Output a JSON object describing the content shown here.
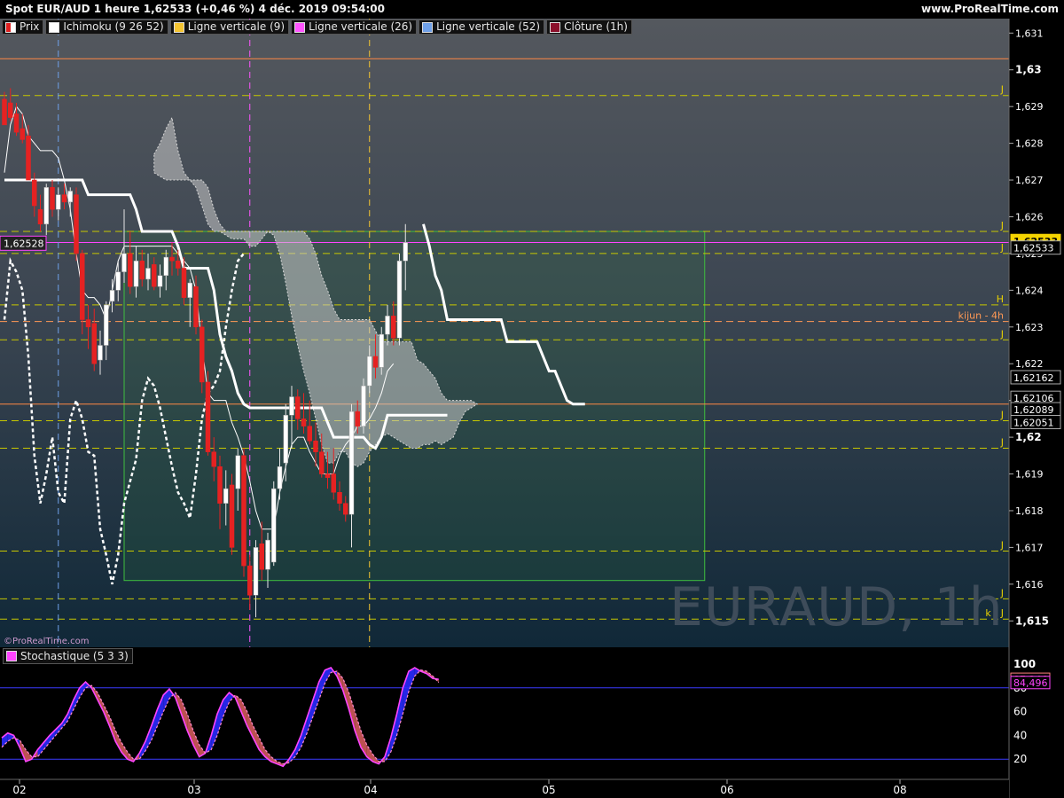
{
  "header": {
    "title": "Spot EUR/AUD 1 heure 1,62533 (+0,46 %) 4 déc. 2019 09:54:00",
    "site": "www.ProRealTime.com",
    "copyright": "©ProRealTime.com",
    "watermark": "EURAUD, 1h"
  },
  "legend": [
    {
      "label": "Prix",
      "color": "#ffffff",
      "accent": "#e02020"
    },
    {
      "label": "Ichimoku (9 26 52)",
      "color": "#ffffff"
    },
    {
      "label": "Ligne verticale (9)",
      "color": "#f5c531"
    },
    {
      "label": "Ligne verticale (26)",
      "color": "#ff55ff"
    },
    {
      "label": "Ligne verticale (52)",
      "color": "#6fa0e8"
    },
    {
      "label": "Clôture (1h)",
      "color": "#8b0f2a"
    }
  ],
  "stoch_legend": {
    "label": "Stochastique (5 3 3)",
    "color": "#ff44ff"
  },
  "chart_data": [
    {
      "type": "candlestick",
      "title": "Spot EUR/AUD 1 heure",
      "x_ticks": [
        "02",
        "03",
        "04",
        "05",
        "06",
        "08"
      ],
      "ylim": [
        1.6145,
        1.6312
      ],
      "y_ticks": [
        "1,631",
        "1,63",
        "1,629",
        "1,628",
        "1,627",
        "1,626",
        "1,625",
        "1,624",
        "1,623",
        "1,622",
        "1,621",
        "1,62",
        "1,619",
        "1,618",
        "1,617",
        "1,616",
        "1,615"
      ],
      "y_tick_values": [
        1.631,
        1.63,
        1.629,
        1.628,
        1.627,
        1.626,
        1.625,
        1.624,
        1.623,
        1.622,
        1.621,
        1.62,
        1.619,
        1.618,
        1.617,
        1.616,
        1.615
      ],
      "bold_ticks": [
        "1,63",
        "1,62",
        "1,615"
      ],
      "price_tags": [
        {
          "label": "1,62533",
          "value": 1.62533,
          "style": "last",
          "bg": "#f5d400",
          "fg": "#000000"
        },
        {
          "label": "1,62533",
          "value": 1.62515,
          "style": "plain"
        },
        {
          "label": "1,62162",
          "value": 1.62162,
          "style": "plain"
        },
        {
          "label": "1,62106",
          "value": 1.62106,
          "style": "plain"
        },
        {
          "label": "1,62089",
          "value": 1.62075,
          "style": "plain"
        },
        {
          "label": "1,62051",
          "value": 1.6204,
          "style": "plain"
        }
      ],
      "left_tag": {
        "label": "1,62528",
        "value": 1.62528
      },
      "level_lines": [
        {
          "value": 1.6303,
          "color": "#ff8844",
          "style": "solid",
          "label": ""
        },
        {
          "value": 1.6293,
          "color": "#c8c800",
          "style": "dash",
          "label": "J"
        },
        {
          "value": 1.6256,
          "color": "#c8c800",
          "style": "dash",
          "label": "J"
        },
        {
          "value": 1.6253,
          "color": "#ff44ff",
          "style": "solid",
          "label": ""
        },
        {
          "value": 1.625,
          "color": "#c8c800",
          "style": "dash",
          "label": "J"
        },
        {
          "value": 1.6236,
          "color": "#c8c800",
          "style": "dash",
          "label": "H"
        },
        {
          "value": 1.62315,
          "color": "#ff9955",
          "style": "dash",
          "label": "kijun - 4h"
        },
        {
          "value": 1.62265,
          "color": "#c8c800",
          "style": "dash",
          "label": "J"
        },
        {
          "value": 1.6209,
          "color": "#ff8844",
          "style": "solid",
          "label": ""
        },
        {
          "value": 1.62045,
          "color": "#c8c800",
          "style": "dash",
          "label": "J"
        },
        {
          "value": 1.6197,
          "color": "#c8c800",
          "style": "dash",
          "label": "J"
        },
        {
          "value": 1.6169,
          "color": "#c8c800",
          "style": "dash",
          "label": "J"
        },
        {
          "value": 1.6156,
          "color": "#c8c800",
          "style": "dash",
          "label": "J"
        },
        {
          "value": 1.61505,
          "color": "#c8c800",
          "style": "dash",
          "label": "k - J"
        }
      ],
      "candles": [
        {
          "o": 1.6292,
          "h": 1.6294,
          "l": 1.6286,
          "c": 1.6285
        },
        {
          "o": 1.6291,
          "h": 1.6295,
          "l": 1.6286,
          "c": 1.6287
        },
        {
          "o": 1.6288,
          "h": 1.6291,
          "l": 1.6282,
          "c": 1.6283
        },
        {
          "o": 1.6284,
          "h": 1.6288,
          "l": 1.628,
          "c": 1.6281
        },
        {
          "o": 1.6282,
          "h": 1.6285,
          "l": 1.6275,
          "c": 1.627
        },
        {
          "o": 1.627,
          "h": 1.6272,
          "l": 1.626,
          "c": 1.6263
        },
        {
          "o": 1.6262,
          "h": 1.6266,
          "l": 1.6256,
          "c": 1.6258
        },
        {
          "o": 1.6258,
          "h": 1.6269,
          "l": 1.6255,
          "c": 1.6268
        },
        {
          "o": 1.6268,
          "h": 1.627,
          "l": 1.626,
          "c": 1.6262
        },
        {
          "o": 1.6262,
          "h": 1.6268,
          "l": 1.6259,
          "c": 1.6266
        },
        {
          "o": 1.6266,
          "h": 1.6269,
          "l": 1.6262,
          "c": 1.6264
        },
        {
          "o": 1.6264,
          "h": 1.6268,
          "l": 1.626,
          "c": 1.6267
        },
        {
          "o": 1.6266,
          "h": 1.6268,
          "l": 1.6248,
          "c": 1.625
        },
        {
          "o": 1.625,
          "h": 1.6251,
          "l": 1.6228,
          "c": 1.6232
        },
        {
          "o": 1.6232,
          "h": 1.6236,
          "l": 1.6224,
          "c": 1.623
        },
        {
          "o": 1.6231,
          "h": 1.6235,
          "l": 1.6218,
          "c": 1.622
        },
        {
          "o": 1.6221,
          "h": 1.6229,
          "l": 1.6217,
          "c": 1.6225
        },
        {
          "o": 1.6225,
          "h": 1.6237,
          "l": 1.6221,
          "c": 1.6236
        },
        {
          "o": 1.6237,
          "h": 1.6243,
          "l": 1.6234,
          "c": 1.624
        },
        {
          "o": 1.624,
          "h": 1.6248,
          "l": 1.6237,
          "c": 1.6245
        },
        {
          "o": 1.6245,
          "h": 1.6262,
          "l": 1.6242,
          "c": 1.625
        },
        {
          "o": 1.625,
          "h": 1.6256,
          "l": 1.6239,
          "c": 1.6241
        },
        {
          "o": 1.6241,
          "h": 1.6252,
          "l": 1.6238,
          "c": 1.6248
        },
        {
          "o": 1.6248,
          "h": 1.6251,
          "l": 1.6241,
          "c": 1.6243
        },
        {
          "o": 1.6243,
          "h": 1.625,
          "l": 1.624,
          "c": 1.6246
        },
        {
          "o": 1.6247,
          "h": 1.6249,
          "l": 1.624,
          "c": 1.6241
        },
        {
          "o": 1.6241,
          "h": 1.6247,
          "l": 1.6238,
          "c": 1.6244
        },
        {
          "o": 1.6244,
          "h": 1.6251,
          "l": 1.624,
          "c": 1.6249
        },
        {
          "o": 1.6249,
          "h": 1.6253,
          "l": 1.6244,
          "c": 1.6248
        },
        {
          "o": 1.6248,
          "h": 1.6251,
          "l": 1.6244,
          "c": 1.6246
        },
        {
          "o": 1.6246,
          "h": 1.6249,
          "l": 1.6236,
          "c": 1.6238
        },
        {
          "o": 1.6238,
          "h": 1.6243,
          "l": 1.623,
          "c": 1.6242
        },
        {
          "o": 1.6241,
          "h": 1.6244,
          "l": 1.6228,
          "c": 1.623
        },
        {
          "o": 1.623,
          "h": 1.6232,
          "l": 1.6212,
          "c": 1.6215
        },
        {
          "o": 1.6215,
          "h": 1.6218,
          "l": 1.6195,
          "c": 1.6196
        },
        {
          "o": 1.6196,
          "h": 1.62,
          "l": 1.6188,
          "c": 1.6192
        },
        {
          "o": 1.6192,
          "h": 1.6195,
          "l": 1.6175,
          "c": 1.6182
        },
        {
          "o": 1.6182,
          "h": 1.6191,
          "l": 1.6176,
          "c": 1.6186
        },
        {
          "o": 1.6187,
          "h": 1.619,
          "l": 1.6168,
          "c": 1.617
        },
        {
          "o": 1.6186,
          "h": 1.6197,
          "l": 1.618,
          "c": 1.6195
        },
        {
          "o": 1.6195,
          "h": 1.6197,
          "l": 1.6162,
          "c": 1.6165
        },
        {
          "o": 1.6165,
          "h": 1.6168,
          "l": 1.6153,
          "c": 1.6157
        },
        {
          "o": 1.6157,
          "h": 1.6172,
          "l": 1.6151,
          "c": 1.617
        },
        {
          "o": 1.6171,
          "h": 1.6177,
          "l": 1.6161,
          "c": 1.6164
        },
        {
          "o": 1.6164,
          "h": 1.6174,
          "l": 1.6159,
          "c": 1.6172
        },
        {
          "o": 1.6166,
          "h": 1.6188,
          "l": 1.6165,
          "c": 1.6186
        },
        {
          "o": 1.6186,
          "h": 1.6197,
          "l": 1.6183,
          "c": 1.6192
        },
        {
          "o": 1.6193,
          "h": 1.6209,
          "l": 1.6188,
          "c": 1.6206
        },
        {
          "o": 1.6206,
          "h": 1.6214,
          "l": 1.6197,
          "c": 1.6211
        },
        {
          "o": 1.6211,
          "h": 1.6213,
          "l": 1.6202,
          "c": 1.6205
        },
        {
          "o": 1.6205,
          "h": 1.6212,
          "l": 1.6201,
          "c": 1.6203
        },
        {
          "o": 1.6203,
          "h": 1.621,
          "l": 1.6198,
          "c": 1.6199
        },
        {
          "o": 1.6199,
          "h": 1.6204,
          "l": 1.6192,
          "c": 1.6196
        },
        {
          "o": 1.6196,
          "h": 1.6201,
          "l": 1.6189,
          "c": 1.619
        },
        {
          "o": 1.619,
          "h": 1.6196,
          "l": 1.6186,
          "c": 1.6189
        },
        {
          "o": 1.619,
          "h": 1.6197,
          "l": 1.6183,
          "c": 1.6185
        },
        {
          "o": 1.6185,
          "h": 1.6188,
          "l": 1.618,
          "c": 1.6182
        },
        {
          "o": 1.6182,
          "h": 1.6184,
          "l": 1.6177,
          "c": 1.6179
        },
        {
          "o": 1.6179,
          "h": 1.6209,
          "l": 1.617,
          "c": 1.6207
        },
        {
          "o": 1.6207,
          "h": 1.621,
          "l": 1.6201,
          "c": 1.6203
        },
        {
          "o": 1.6203,
          "h": 1.6216,
          "l": 1.6201,
          "c": 1.6214
        },
        {
          "o": 1.6214,
          "h": 1.6225,
          "l": 1.6212,
          "c": 1.6222
        },
        {
          "o": 1.6222,
          "h": 1.6228,
          "l": 1.6216,
          "c": 1.6219
        },
        {
          "o": 1.6219,
          "h": 1.623,
          "l": 1.6217,
          "c": 1.6228
        },
        {
          "o": 1.6228,
          "h": 1.6236,
          "l": 1.6225,
          "c": 1.6233
        },
        {
          "o": 1.6233,
          "h": 1.6237,
          "l": 1.6225,
          "c": 1.6227
        },
        {
          "o": 1.6227,
          "h": 1.625,
          "l": 1.6225,
          "c": 1.6248
        },
        {
          "o": 1.6248,
          "h": 1.6258,
          "l": 1.624,
          "c": 1.6253
        }
      ],
      "ichimoku": {
        "tenkan": [
          1.6271,
          1.627,
          1.627,
          1.627,
          1.627,
          1.627,
          1.627,
          1.6266,
          1.6266,
          1.6265,
          1.6264,
          1.6264,
          1.6262,
          1.6262,
          1.6262,
          1.6262,
          1.6262,
          1.6262,
          1.6262,
          1.6262,
          1.6262,
          1.6262,
          1.6262,
          1.6262,
          1.6262,
          1.6262,
          1.6262,
          1.6262,
          1.6262,
          1.6262,
          1.6258,
          1.6248,
          1.6245,
          1.624,
          1.623,
          1.6222,
          1.6215,
          1.6215,
          1.6212,
          1.621,
          1.6208,
          1.6208,
          1.6208,
          1.6208,
          1.6208,
          1.6208,
          1.6208,
          1.6208,
          1.6208,
          1.6208,
          1.6208,
          1.6206,
          1.6205,
          1.6204,
          1.6204,
          1.6204,
          1.6201,
          1.6198,
          1.6198,
          1.6205,
          1.6205,
          1.6205,
          1.6205,
          1.6209,
          1.6219,
          1.6229,
          1.6245,
          1.6252
        ],
        "kijun": [
          1.627,
          1.627,
          1.627,
          1.627,
          1.627,
          1.627,
          1.627,
          1.627,
          1.627,
          1.627,
          1.6268,
          1.6267,
          1.6266,
          1.6266,
          1.6266,
          1.6266,
          1.6266,
          1.6266,
          1.6266,
          1.6266,
          1.6266,
          1.6266,
          1.6266,
          1.6266,
          1.6266,
          1.6266,
          1.6266,
          1.6266,
          1.6266,
          1.6266,
          1.6266,
          1.6266,
          1.6266,
          1.6266,
          1.6266,
          1.6266,
          1.6266,
          1.6266,
          1.6266,
          1.6266,
          1.6266,
          1.6266,
          1.6266,
          1.6266,
          1.6266,
          1.6266,
          1.6266,
          1.6266,
          1.6266,
          1.6266,
          1.6266,
          1.6266,
          1.6266,
          1.6266,
          1.6266,
          1.6266,
          1.6266,
          1.6266,
          1.6266,
          1.6266,
          1.6266,
          1.6266,
          1.6266,
          1.6266,
          1.6266,
          1.6266,
          1.6266,
          1.6266
        ],
        "chikou": [
          1.6232,
          1.6248,
          1.6245,
          1.624,
          1.6222,
          1.6195,
          1.6182,
          1.619,
          1.62,
          1.6185,
          1.6182,
          1.6205,
          1.621,
          1.6205,
          1.6196,
          1.6195,
          1.6175,
          1.6168,
          1.616,
          1.6168,
          1.6182,
          1.6188,
          1.6194,
          1.621,
          1.6216,
          1.6214,
          1.6208,
          1.62,
          1.6192,
          1.6185,
          1.6182,
          1.6178,
          1.619,
          1.6205,
          1.6212,
          1.6214,
          1.6218,
          1.623,
          1.624,
          1.6248,
          1.625
        ]
      },
      "green_box": {
        "x_from": 20,
        "x_to": 117,
        "y_from": 1.6161,
        "y_to": 1.6256
      },
      "vertical_lines": [
        {
          "x_index": 9,
          "color": "#6fa0e8"
        },
        {
          "x_index": 41,
          "color": "#ff55ff"
        },
        {
          "x_index": 61,
          "color": "#f5c531"
        }
      ]
    },
    {
      "type": "line",
      "title": "Stochastique (5 3 3)",
      "ylim": [
        0,
        100
      ],
      "y_ticks": [
        "100",
        "80",
        "60",
        "40",
        "20"
      ],
      "y_tick_values": [
        100,
        80,
        60,
        40,
        20
      ],
      "levels": [
        80,
        20
      ],
      "values_labels": [
        {
          "label": "87,246",
          "value": 87.246,
          "color": "#ff8080"
        },
        {
          "label": "84,496",
          "value": 84.496,
          "color": "#ff44ff"
        }
      ],
      "series": [
        {
          "name": "%K",
          "color": "#ff44ff",
          "values": [
            38,
            42,
            40,
            30,
            18,
            20,
            28,
            34,
            40,
            45,
            50,
            58,
            70,
            80,
            85,
            80,
            70,
            60,
            48,
            35,
            26,
            20,
            18,
            25,
            35,
            48,
            62,
            74,
            79,
            72,
            58,
            44,
            32,
            22,
            25,
            40,
            58,
            70,
            76,
            72,
            60,
            48,
            38,
            28,
            22,
            18,
            16,
            14,
            20,
            28,
            40,
            55,
            70,
            85,
            95,
            97,
            90,
            78,
            62,
            44,
            30,
            22,
            18,
            16,
            22,
            38,
            58,
            80,
            94,
            97,
            94,
            92,
            88,
            87.2
          ]
        },
        {
          "name": "%D",
          "color": "#ff88cc",
          "values": [
            30,
            35,
            38,
            36,
            28,
            22,
            22,
            28,
            34,
            40,
            46,
            52,
            62,
            72,
            80,
            82,
            76,
            66,
            56,
            44,
            34,
            26,
            20,
            20,
            27,
            36,
            48,
            60,
            71,
            76,
            70,
            58,
            44,
            32,
            25,
            28,
            40,
            56,
            68,
            74,
            70,
            60,
            48,
            38,
            28,
            22,
            18,
            16,
            17,
            22,
            30,
            42,
            56,
            70,
            84,
            93,
            94,
            88,
            76,
            60,
            44,
            32,
            24,
            18,
            18,
            26,
            40,
            58,
            77,
            90,
            95,
            94,
            90,
            84.5
          ]
        }
      ]
    }
  ],
  "axes": {
    "x_tick_positions_index": [
      2,
      46,
      90,
      134,
      178,
      222
    ]
  }
}
